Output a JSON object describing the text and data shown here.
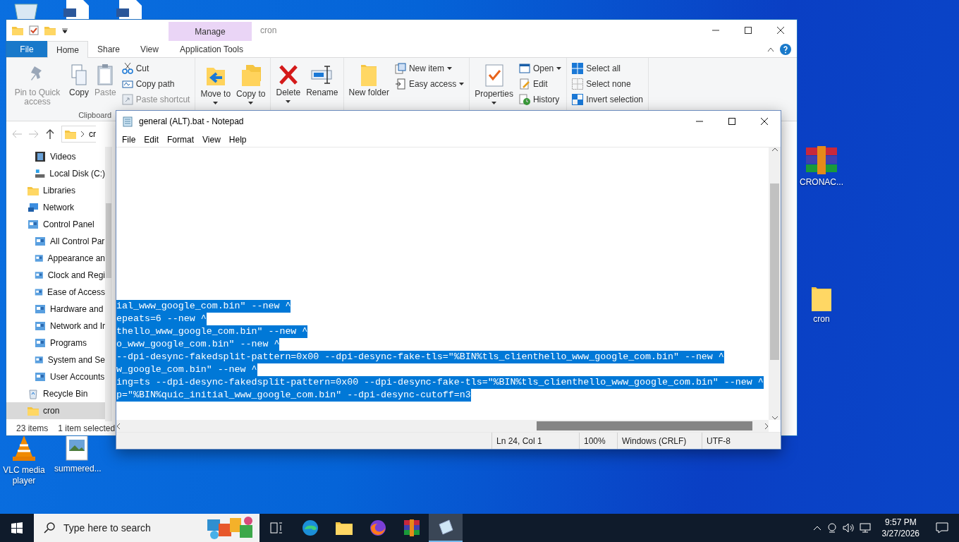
{
  "desktop": {
    "icons_left": [
      {
        "label": "VLC media player"
      },
      {
        "label": "summered..."
      }
    ],
    "icons_right": [
      {
        "label": "CRONAC..."
      },
      {
        "label": "cron"
      }
    ]
  },
  "explorer": {
    "title": "cron",
    "context_header": "Manage",
    "tabs": [
      {
        "label": "File",
        "selected": false
      },
      {
        "label": "Home",
        "selected": true
      },
      {
        "label": "Share",
        "selected": false
      },
      {
        "label": "View",
        "selected": false
      },
      {
        "label": "Application Tools",
        "selected": false
      }
    ],
    "groups": [
      {
        "label": "Clipboard",
        "large": [
          {
            "label": "Pin to Quick access",
            "disabled": true,
            "dropdown": false
          },
          {
            "label": "Copy",
            "disabled": false,
            "dropdown": false
          },
          {
            "label": "Paste",
            "disabled": true,
            "dropdown": false
          }
        ],
        "small": [
          {
            "label": "Cut",
            "disabled": false,
            "dropdown": false
          },
          {
            "label": "Copy path",
            "disabled": false,
            "dropdown": false
          },
          {
            "label": "Paste shortcut",
            "disabled": true,
            "dropdown": false
          }
        ]
      },
      {
        "large": [
          {
            "label": "Move to",
            "disabled": false,
            "dropdown": true
          },
          {
            "label": "Copy to",
            "disabled": false,
            "dropdown": true
          }
        ]
      },
      {
        "large": [
          {
            "label": "Delete",
            "disabled": false,
            "dropdown": true
          },
          {
            "label": "Rename",
            "disabled": false,
            "dropdown": false
          }
        ]
      },
      {
        "large": [
          {
            "label": "New folder",
            "disabled": false,
            "dropdown": false
          }
        ],
        "small": [
          {
            "label": "New item",
            "disabled": false,
            "dropdown": true
          },
          {
            "label": "Easy access",
            "disabled": false,
            "dropdown": true
          }
        ]
      },
      {
        "large": [
          {
            "label": "Properties",
            "disabled": false,
            "dropdown": true
          }
        ],
        "small": [
          {
            "label": "Open",
            "disabled": false,
            "dropdown": true
          },
          {
            "label": "Edit",
            "disabled": false,
            "dropdown": false
          },
          {
            "label": "History",
            "disabled": false,
            "dropdown": false
          }
        ]
      },
      {
        "small": [
          {
            "label": "Select all",
            "disabled": false,
            "dropdown": false
          },
          {
            "label": "Select none",
            "disabled": false,
            "dropdown": false
          },
          {
            "label": "Invert selection",
            "disabled": false,
            "dropdown": false
          }
        ]
      }
    ],
    "address": "cr",
    "nav_continued": [
      {
        "label": "Videos",
        "selected": false
      },
      {
        "label": "Local Disk (C:)",
        "selected": false
      }
    ],
    "nav": [
      {
        "label": "Libraries",
        "selected": false
      },
      {
        "label": "Network",
        "selected": false
      },
      {
        "label": "Control Panel",
        "selected": false,
        "children": [
          {
            "label": "All Control Par",
            "selected": false
          },
          {
            "label": "Appearance an",
            "selected": false
          },
          {
            "label": "Clock and Regi",
            "selected": false
          },
          {
            "label": "Ease of Access",
            "selected": false
          },
          {
            "label": "Hardware and",
            "selected": false
          },
          {
            "label": "Network and Ir",
            "selected": false
          },
          {
            "label": "Programs",
            "selected": false
          },
          {
            "label": "System and Se",
            "selected": false
          },
          {
            "label": "User Accounts",
            "selected": false
          }
        ]
      },
      {
        "label": "Recycle Bin",
        "selected": false
      },
      {
        "label": "cron",
        "selected": true
      }
    ],
    "status": [
      "23 items",
      "1 item selected"
    ]
  },
  "notepad": {
    "title": "general (ALT).bat - Notepad",
    "menu": [
      "File",
      "Edit",
      "Format",
      "View",
      "Help"
    ],
    "selected": true,
    "lines": [
      "ial_www_google_com.bin\" --new ^",
      "epeats=6 --new ^",
      "thello_www_google_com.bin\" --new ^",
      "o_www_google_com.bin\" --new ^",
      "--dpi-desync-fakedsplit-pattern=0x00 --dpi-desync-fake-tls=\"%BIN%tls_clienthello_www_google_com.bin\" --new ^",
      "w_google_com.bin\" --new ^",
      "ing=ts --dpi-desync-fakedsplit-pattern=0x00 --dpi-desync-fake-tls=\"%BIN%tls_clienthello_www_google_com.bin\" --new ^",
      "p=\"%BIN%quic_initial_www_google_com.bin\" --dpi-desync-cutoff=n3"
    ],
    "status": [
      "Ln 24, Col 1",
      "100%",
      "Windows (CRLF)",
      "UTF-8"
    ]
  },
  "taskbar": {
    "search_placeholder": "Type here to search",
    "apps": [
      {
        "active": false
      },
      {
        "active": false
      },
      {
        "active": false
      },
      {
        "active": false
      },
      {
        "active": false
      },
      {
        "active": true
      }
    ],
    "time": "9:57 PM",
    "date": "3/27/2026"
  }
}
